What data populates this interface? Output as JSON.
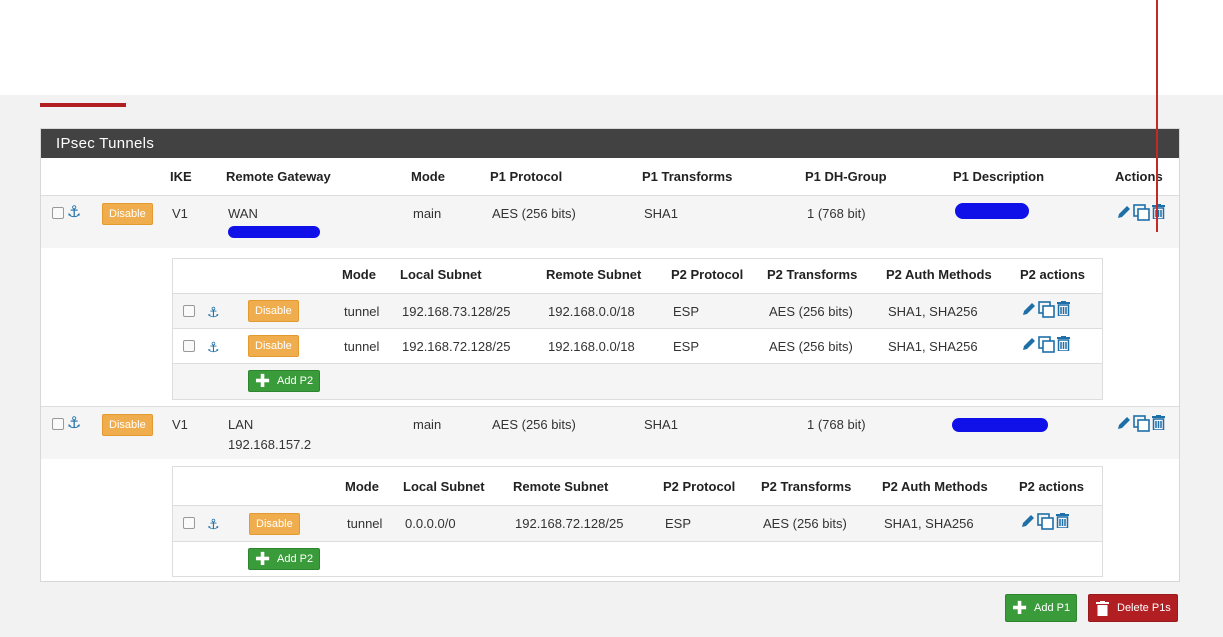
{
  "panel": {
    "title": "IPsec Tunnels"
  },
  "p1_headers": {
    "ike": "IKE",
    "remote_gateway": "Remote Gateway",
    "mode": "Mode",
    "p1_protocol": "P1 Protocol",
    "p1_transforms": "P1 Transforms",
    "p1_dh_group": "P1 DH-Group",
    "p1_description": "P1 Description",
    "actions": "Actions"
  },
  "p2_headers": {
    "mode": "Mode",
    "local_subnet": "Local Subnet",
    "remote_subnet": "Remote Subnet",
    "p2_protocol": "P2 Protocol",
    "p2_transforms": "P2 Transforms",
    "p2_auth_methods": "P2 Auth Methods",
    "p2_actions": "P2 actions"
  },
  "buttons": {
    "disable": "Disable",
    "add_p2": "Add P2",
    "add_p1": "Add P1",
    "delete_p1s": "Delete P1s"
  },
  "tunnels": [
    {
      "ike": "V1",
      "remote_gateway_line1": "WAN",
      "remote_gateway_line2": "",
      "mode": "main",
      "p1_protocol": "AES (256 bits)",
      "p1_transforms": "SHA1",
      "p1_dh_group": "1 (768 bit)",
      "p1_description": "",
      "p2": [
        {
          "mode": "tunnel",
          "local_subnet": "192.168.73.128/25",
          "remote_subnet": "192.168.0.0/18",
          "protocol": "ESP",
          "transforms": "AES (256 bits)",
          "auth_methods": "SHA1, SHA256"
        },
        {
          "mode": "tunnel",
          "local_subnet": "192.168.72.128/25",
          "remote_subnet": "192.168.0.0/18",
          "protocol": "ESP",
          "transforms": "AES (256 bits)",
          "auth_methods": "SHA1, SHA256"
        }
      ]
    },
    {
      "ike": "V1",
      "remote_gateway_line1": "LAN",
      "remote_gateway_line2": "192.168.157.2",
      "mode": "main",
      "p1_protocol": "AES (256 bits)",
      "p1_transforms": "SHA1",
      "p1_dh_group": "1 (768 bit)",
      "p1_description": "",
      "p2": [
        {
          "mode": "tunnel",
          "local_subnet": "0.0.0.0/0",
          "remote_subnet": "192.168.72.128/25",
          "protocol": "ESP",
          "transforms": "AES (256 bits)",
          "auth_methods": "SHA1, SHA256"
        }
      ]
    }
  ],
  "colors": {
    "header_bg": "#424242",
    "accent_red": "#b21f23",
    "disable_orange": "#f0ad4e",
    "add_green": "#3a9b3a",
    "icon_blue": "#1e6fa8",
    "redaction_blue": "#1010e8"
  }
}
